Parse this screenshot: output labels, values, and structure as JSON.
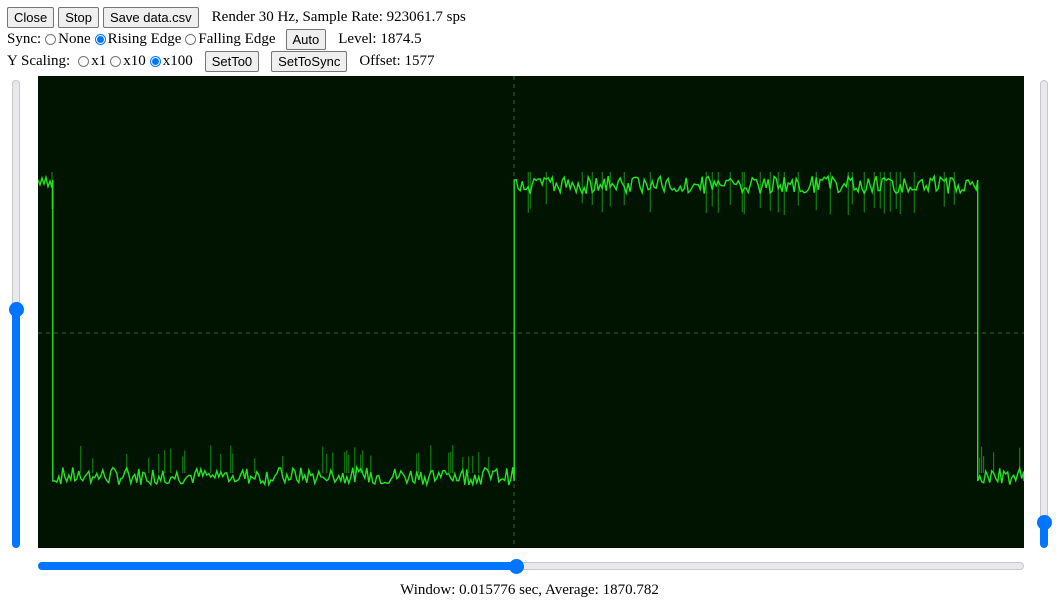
{
  "toolbar": {
    "close_label": "Close",
    "stop_label": "Stop",
    "save_label": "Save data.csv",
    "render_text": "Render 30 Hz, Sample Rate: 923061.7 sps"
  },
  "sync": {
    "label": "Sync:",
    "options": [
      "None",
      "Rising Edge",
      "Falling Edge"
    ],
    "selected": "Rising Edge",
    "auto_label": "Auto",
    "level_text": "Level: 1874.5"
  },
  "yscale": {
    "label": "Y Scaling:",
    "options": [
      "x1",
      "x10",
      "x100"
    ],
    "selected": "x100",
    "setto0_label": "SetTo0",
    "settosync_label": "SetToSync",
    "offset_text": "Offset: 1577"
  },
  "scope": {
    "background": "#011401",
    "trace_color": "#22e622",
    "grid_color": "#2a6a2a",
    "waveform": "square",
    "segments": [
      {
        "state": "high",
        "start": 0.0,
        "end": 0.015
      },
      {
        "state": "low",
        "start": 0.015,
        "end": 0.483
      },
      {
        "state": "high",
        "start": 0.483,
        "end": 0.953
      },
      {
        "state": "low",
        "start": 0.953,
        "end": 1.0
      }
    ]
  },
  "sliders": {
    "left_vertical_value": 0.51,
    "right_vertical_value": 0.04,
    "horizontal_value": 0.484,
    "accent_color": "#0075ff"
  },
  "status": {
    "text": "Window: 0.015776 sec, Average: 1870.782"
  }
}
